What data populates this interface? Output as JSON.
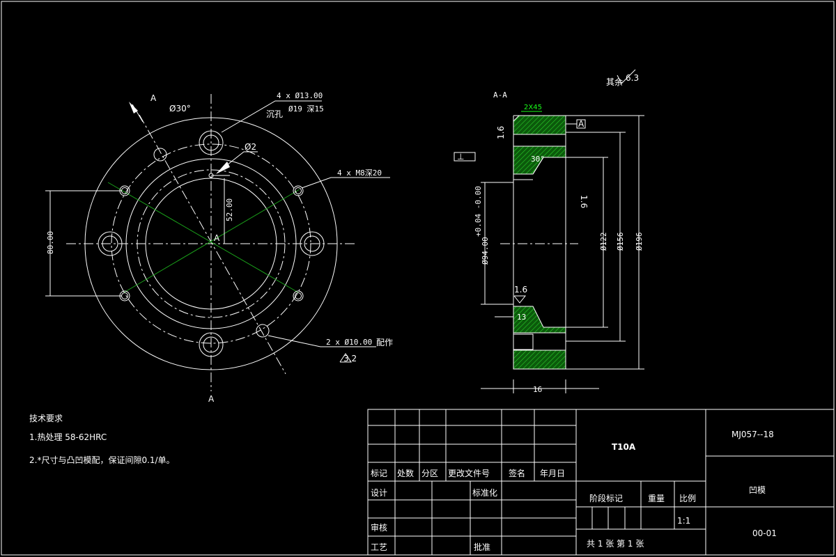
{
  "front_view": {
    "section_mark_top": "A",
    "section_mark_bottom": "A",
    "center_mark": "A",
    "angle": "Ø30°",
    "hole_counterbore": "4 x Ø13.00",
    "hole_counterbore_note": "沉孔",
    "hole_counterbore_depth": "Ø19 深15",
    "small_hole": "Ø2",
    "threaded_holes": "4 x M8深20",
    "dim_vertical_52": "52.00",
    "dim_80": "80.00",
    "pin_holes": "2 x Ø10.00",
    "pin_holes_note": "配作",
    "roughness_a": "3.2"
  },
  "section_view": {
    "title": "A-A",
    "chamfer": "2X45",
    "datum_ref": "A",
    "perp_tol": "⊥",
    "roughness_top": "1.6",
    "roughness_right": "1.6",
    "roughness_mid": "1.6",
    "angle_30": "30°",
    "dim_94": "Ø94.00",
    "tol_94": "+0.04 -0.00",
    "dim_122": "Ø122",
    "dim_156": "Ø156",
    "dim_196": "Ø196",
    "dim_13": "13",
    "dim_16": "16",
    "general_roughness_label": "其余",
    "general_roughness": "6.3"
  },
  "tech_requirements": {
    "heading": "技术要求",
    "item1": "1.热处理 58-62HRC",
    "item2": "2.*尺寸与凸凹模配，保证间隙0.1/单。"
  },
  "title_block": {
    "material": "T10A",
    "drawing_no": "MJ057--18",
    "part_name": "凹模",
    "code": "00-01",
    "scale": "1:1",
    "sheet_info": "共 1 张 第 1 张",
    "col_mark": "标记",
    "col_count": "处数",
    "col_zone": "分区",
    "col_doc": "更改文件号",
    "col_sign": "签名",
    "col_date": "年月日",
    "row_design": "设计",
    "row_standard": "标准化",
    "row_review": "审核",
    "row_process": "工艺",
    "row_approve": "批准",
    "stage_mark": "阶段标记",
    "weight": "重量",
    "scale_label": "比例"
  },
  "colors": {
    "background": "#000000",
    "line": "#ffffff",
    "hatch": "#1aa01a",
    "highlight": "#19ff19"
  }
}
